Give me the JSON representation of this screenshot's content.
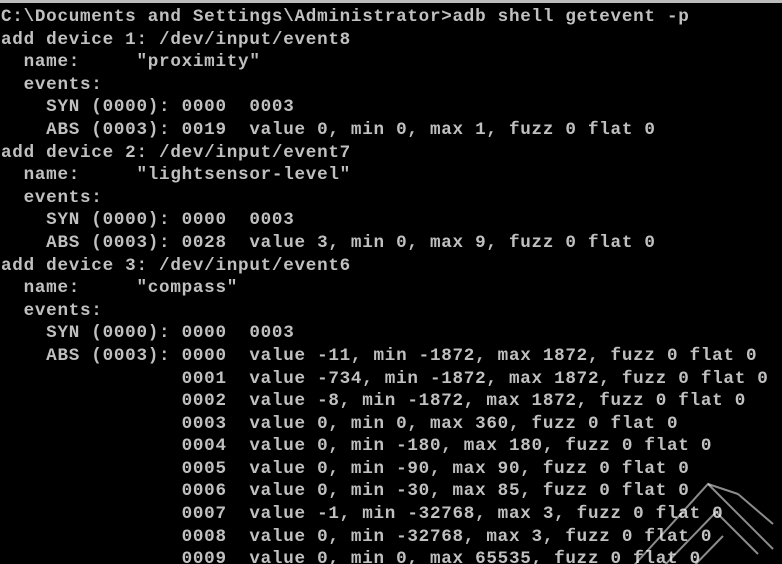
{
  "console": {
    "text_color": "#c0c0c0",
    "background_color": "#000000",
    "lines": [
      "C:\\Documents and Settings\\Administrator>adb shell getevent -p",
      "add device 1: /dev/input/event8",
      "  name:     \"proximity\"",
      "  events:",
      "    SYN (0000): 0000  0003",
      "    ABS (0003): 0019  value 0, min 0, max 1, fuzz 0 flat 0",
      "add device 2: /dev/input/event7",
      "  name:     \"lightsensor-level\"",
      "  events:",
      "    SYN (0000): 0000  0003",
      "    ABS (0003): 0028  value 3, min 0, max 9, fuzz 0 flat 0",
      "add device 3: /dev/input/event6",
      "  name:     \"compass\"",
      "  events:",
      "    SYN (0000): 0000  0003",
      "    ABS (0003): 0000  value -11, min -1872, max 1872, fuzz 0 flat 0",
      "                0001  value -734, min -1872, max 1872, fuzz 0 flat 0",
      "                0002  value -8, min -1872, max 1872, fuzz 0 flat 0",
      "                0003  value 0, min 0, max 360, fuzz 0 flat 0",
      "                0004  value 0, min -180, max 180, fuzz 0 flat 0",
      "                0005  value 0, min -90, max 90, fuzz 0 flat 0",
      "                0006  value 0, min -30, max 85, fuzz 0 flat 0",
      "                0007  value -1, min -32768, max 3, fuzz 0 flat 0",
      "                0008  value 0, min -32768, max 3, fuzz 0 flat 0",
      "                0009  value 0, min 0, max 65535, fuzz 0 flat 0"
    ]
  }
}
